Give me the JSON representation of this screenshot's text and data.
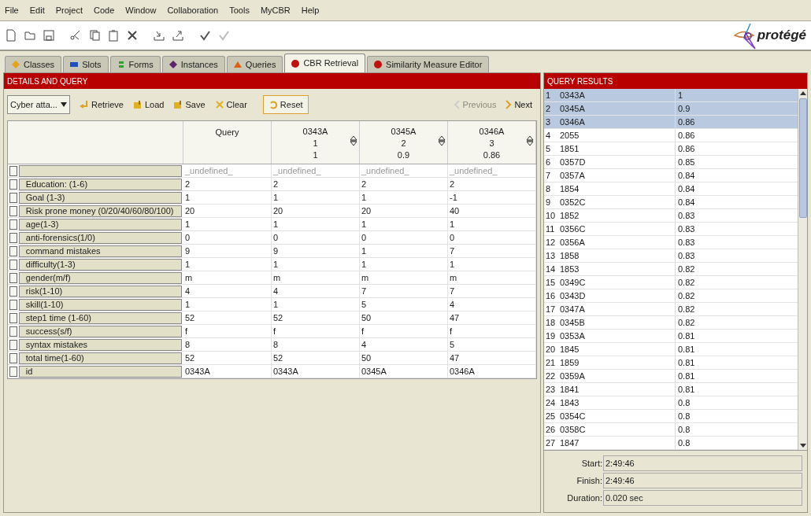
{
  "menu": [
    "File",
    "Edit",
    "Project",
    "Code",
    "Window",
    "Collaboration",
    "Tools",
    "MyCBR",
    "Help"
  ],
  "toolbar": [
    {
      "kind": "new"
    },
    {
      "kind": "open"
    },
    {
      "kind": "save"
    },
    {
      "kind": "cut"
    },
    {
      "kind": "copy"
    },
    {
      "kind": "paste"
    },
    {
      "kind": "delete"
    },
    {
      "kind": "import"
    },
    {
      "kind": "export"
    },
    {
      "kind": "check"
    },
    {
      "kind": "uncheck"
    }
  ],
  "logo": "protégé",
  "tabs": [
    {
      "label": "Classes",
      "kind": "diamond",
      "color": "#e8a020",
      "selected": false
    },
    {
      "label": "Slots",
      "kind": "bar",
      "color": "#2050c0",
      "selected": false
    },
    {
      "label": "Forms",
      "kind": "lines",
      "color": "#30a030",
      "selected": false
    },
    {
      "label": "Instances",
      "kind": "diamond",
      "color": "#602070",
      "selected": false
    },
    {
      "label": "Queries",
      "kind": "triangle",
      "color": "#e06010",
      "selected": false
    },
    {
      "label": "CBR Retrieval",
      "kind": "ball",
      "color": "#c01010",
      "selected": true
    },
    {
      "label": "Similarity Measure Editor",
      "kind": "ball",
      "color": "#c01010",
      "selected": false
    }
  ],
  "details": {
    "title": "DETAILS AND QUERY",
    "dropdown": "Cyber atta...",
    "buttons": [
      {
        "label": "Retrieve",
        "kind": "retrieve",
        "focused": false
      },
      {
        "label": "Load",
        "kind": "load",
        "focused": false
      },
      {
        "label": "Save",
        "kind": "save",
        "focused": false
      },
      {
        "label": "Clear",
        "kind": "clear",
        "focused": false
      },
      {
        "label": "Reset",
        "kind": "reset",
        "focused": true
      }
    ],
    "nav": [
      {
        "label": "Previous",
        "kind": "prev",
        "disabled": true
      },
      {
        "label": "Next",
        "kind": "next",
        "disabled": false
      }
    ],
    "columns": [
      {
        "kind": "query",
        "name": "Query"
      },
      {
        "kind": "case",
        "name": "0343A",
        "rank": "1",
        "similarity": "1"
      },
      {
        "kind": "case",
        "name": "0345A",
        "rank": "2",
        "similarity": "0.9"
      },
      {
        "kind": "case",
        "name": "0346A",
        "rank": "3",
        "similarity": "0.86"
      }
    ],
    "rows": [
      {
        "kind": "class",
        "values": [
          "_undefined_",
          "_undefined_",
          "_undefined_",
          "_undefined_"
        ]
      },
      {
        "kind": "attribute",
        "label": "Education: (1-6)",
        "values": [
          "2",
          "2",
          "2",
          "2"
        ]
      },
      {
        "kind": "attribute",
        "label": "Goal (1-3)",
        "values": [
          "1",
          "1",
          "1",
          "-1"
        ]
      },
      {
        "kind": "attribute",
        "label": "Risk prone money (0/20/40/60/80/100)",
        "values": [
          "20",
          "20",
          "20",
          "40"
        ]
      },
      {
        "kind": "attribute",
        "label": "age(1-3)",
        "values": [
          "1",
          "1",
          "1",
          "1"
        ]
      },
      {
        "kind": "attribute",
        "label": "anti-forensics(1/0)",
        "values": [
          "0",
          "0",
          "0",
          "0"
        ]
      },
      {
        "kind": "attribute",
        "label": "command mistakes",
        "values": [
          "9",
          "9",
          "1",
          "7"
        ]
      },
      {
        "kind": "attribute",
        "label": "difficulty(1-3)",
        "values": [
          "1",
          "1",
          "1",
          "1"
        ]
      },
      {
        "kind": "attribute",
        "label": "gender(m/f)",
        "values": [
          "m",
          "m",
          "m",
          "m"
        ]
      },
      {
        "kind": "attribute",
        "label": "risk(1-10)",
        "values": [
          "4",
          "4",
          "7",
          "7"
        ]
      },
      {
        "kind": "attribute",
        "label": "skill(1-10)",
        "values": [
          "1",
          "1",
          "5",
          "4"
        ]
      },
      {
        "kind": "attribute",
        "label": "step1 time (1-60)",
        "values": [
          "52",
          "52",
          "50",
          "47"
        ]
      },
      {
        "kind": "attribute",
        "label": "success(s/f)",
        "values": [
          "f",
          "f",
          "f",
          "f"
        ]
      },
      {
        "kind": "attribute",
        "label": "syntax mistakes",
        "values": [
          "8",
          "8",
          "4",
          "5"
        ]
      },
      {
        "kind": "attribute",
        "label": "total time(1-60)",
        "values": [
          "52",
          "52",
          "50",
          "47"
        ]
      },
      {
        "kind": "attribute",
        "label": "id",
        "values": [
          "0343A",
          "0343A",
          "0345A",
          "0346A"
        ]
      }
    ]
  },
  "results": {
    "title": "QUERY RESULTS",
    "rows": [
      {
        "rank": "1",
        "id": "0343A",
        "similarity": "1",
        "selected": true
      },
      {
        "rank": "2",
        "id": "0345A",
        "similarity": "0.9",
        "selected": true
      },
      {
        "rank": "3",
        "id": "0346A",
        "similarity": "0.86",
        "selected": true
      },
      {
        "rank": "4",
        "id": "2055",
        "similarity": "0.86",
        "selected": false
      },
      {
        "rank": "5",
        "id": "1851",
        "similarity": "0.86",
        "selected": false
      },
      {
        "rank": "6",
        "id": "0357D",
        "similarity": "0.85",
        "selected": false
      },
      {
        "rank": "7",
        "id": "0357A",
        "similarity": "0.84",
        "selected": false
      },
      {
        "rank": "8",
        "id": "1854",
        "similarity": "0.84",
        "selected": false
      },
      {
        "rank": "9",
        "id": "0352C",
        "similarity": "0.84",
        "selected": false
      },
      {
        "rank": "10",
        "id": "1852",
        "similarity": "0.83",
        "selected": false
      },
      {
        "rank": "11",
        "id": "0356C",
        "similarity": "0.83",
        "selected": false
      },
      {
        "rank": "12",
        "id": "0356A",
        "similarity": "0.83",
        "selected": false
      },
      {
        "rank": "13",
        "id": "1858",
        "similarity": "0.83",
        "selected": false
      },
      {
        "rank": "14",
        "id": "1853",
        "similarity": "0.82",
        "selected": false
      },
      {
        "rank": "15",
        "id": "0349C",
        "similarity": "0.82",
        "selected": false
      },
      {
        "rank": "16",
        "id": "0343D",
        "similarity": "0.82",
        "selected": false
      },
      {
        "rank": "17",
        "id": "0347A",
        "similarity": "0.82",
        "selected": false
      },
      {
        "rank": "18",
        "id": "0345B",
        "similarity": "0.82",
        "selected": false
      },
      {
        "rank": "19",
        "id": "0353A",
        "similarity": "0.81",
        "selected": false
      },
      {
        "rank": "20",
        "id": "1845",
        "similarity": "0.81",
        "selected": false
      },
      {
        "rank": "21",
        "id": "1859",
        "similarity": "0.81",
        "selected": false
      },
      {
        "rank": "22",
        "id": "0359A",
        "similarity": "0.81",
        "selected": false
      },
      {
        "rank": "23",
        "id": "1841",
        "similarity": "0.81",
        "selected": false
      },
      {
        "rank": "24",
        "id": "1843",
        "similarity": "0.8",
        "selected": false
      },
      {
        "rank": "25",
        "id": "0354C",
        "similarity": "0.8",
        "selected": false
      },
      {
        "rank": "26",
        "id": "0358C",
        "similarity": "0.8",
        "selected": false
      },
      {
        "rank": "27",
        "id": "1847",
        "similarity": "0.8",
        "selected": false
      }
    ],
    "times": [
      {
        "label": "Start:",
        "value": "2:49:46"
      },
      {
        "label": "Finish:",
        "value": "2:49:46"
      },
      {
        "label": "Duration:",
        "value": "0.020 sec"
      }
    ]
  }
}
